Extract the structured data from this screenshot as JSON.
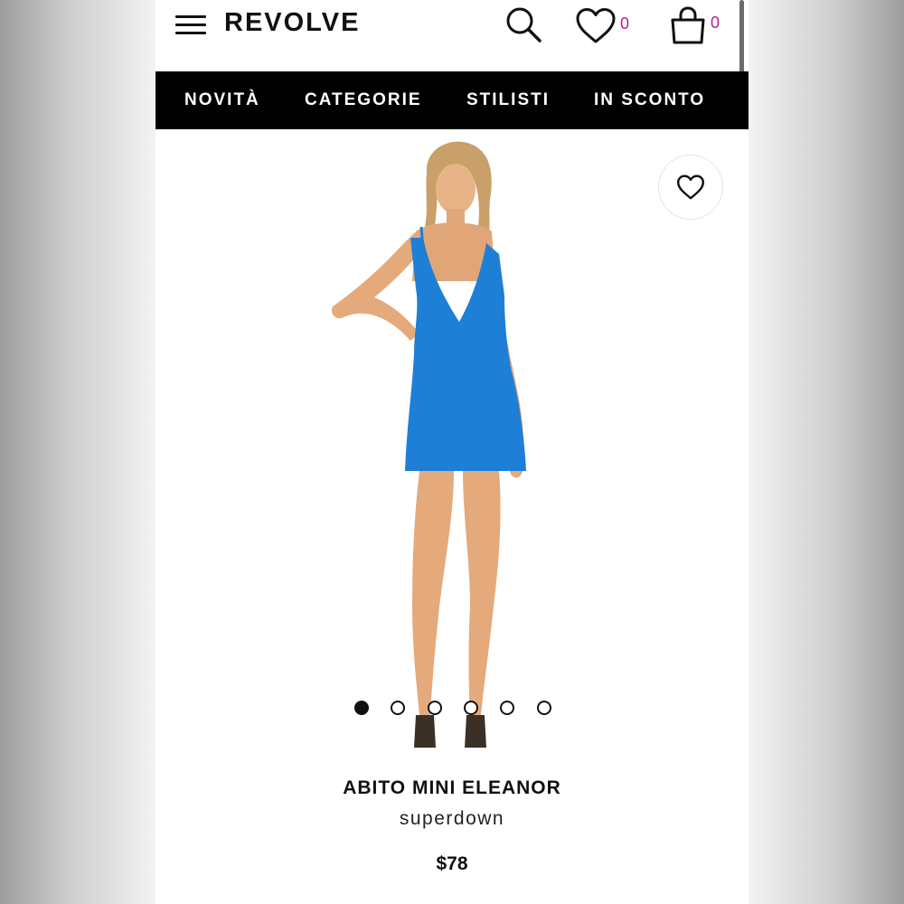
{
  "header": {
    "logo": "REVOLVE",
    "wishlist_count": "0",
    "bag_count": "0",
    "menu_icon": "hamburger-menu-icon",
    "search_icon": "search-icon",
    "wishlist_icon": "heart-icon",
    "bag_icon": "shopping-bag-icon"
  },
  "nav": {
    "items": [
      {
        "label": "NOVITÀ"
      },
      {
        "label": "CATEGORIE"
      },
      {
        "label": "STILISTI"
      },
      {
        "label": "IN SCONTO"
      }
    ]
  },
  "product": {
    "title": "ABITO MINI ELEANOR",
    "brand": "superdown",
    "price": "$78",
    "favorite_icon": "heart-icon",
    "image_count": 6,
    "active_image_index": 0,
    "dress_color": "#1e7fd6"
  },
  "colors": {
    "accent": "#c2188b",
    "nav_background": "#000000"
  }
}
